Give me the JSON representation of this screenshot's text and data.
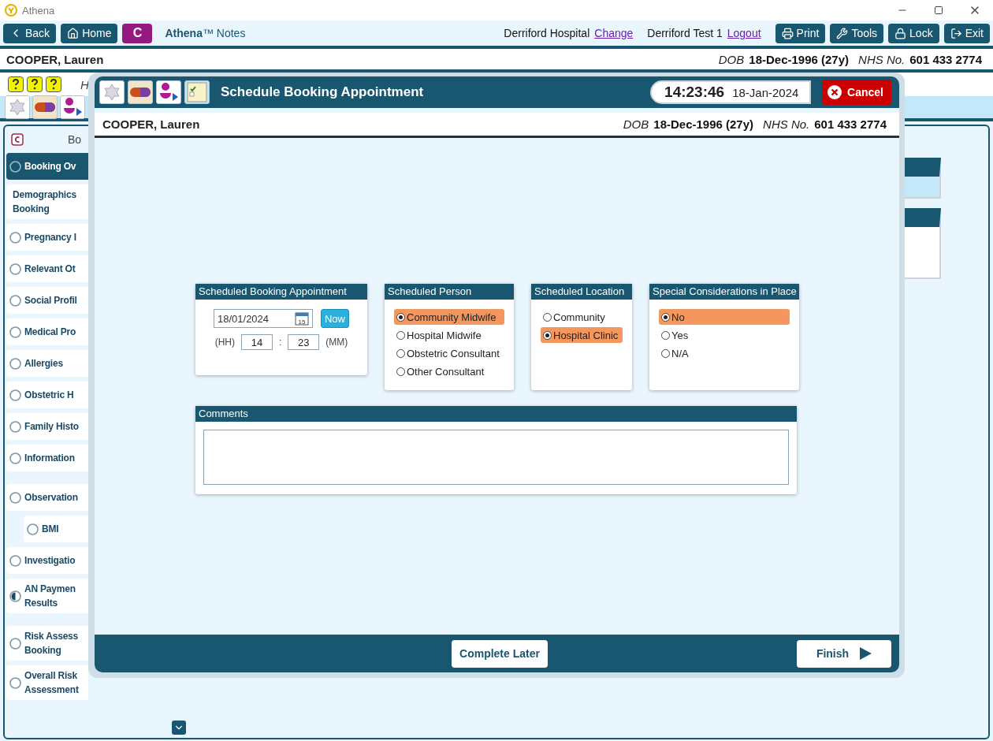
{
  "window": {
    "title": "Athena"
  },
  "toolbar": {
    "back": "Back",
    "home": "Home",
    "module": "C",
    "brand": "**Athena**™ Notes",
    "hospital": "Derriford Hospital",
    "change_link": "Change",
    "user": "Derriford Test 1",
    "logout_link": "Logout",
    "buttons": [
      {
        "kind": "print",
        "label": "Print"
      },
      {
        "kind": "tools",
        "label": "Tools"
      },
      {
        "kind": "lock",
        "label": "Lock"
      },
      {
        "kind": "exit",
        "label": "Exit"
      }
    ]
  },
  "patient": {
    "name": "COOPER, Lauren",
    "dob_label": "DOB",
    "dob": "18-Dec-1996 (27y)",
    "nhs_label": "NHS No.",
    "nhs": "601 433 2774"
  },
  "subheader": {
    "text": "H"
  },
  "sidebar": {
    "header": "Bo",
    "items": [
      {
        "label": "Booking Ov",
        "kind": "empty",
        "selected": true
      },
      {
        "label": "Demographics\nBooking",
        "kind": "plain",
        "selected": false
      },
      {
        "label": "Pregnancy I",
        "kind": "empty",
        "selected": false
      },
      {
        "label": "Relevant Ot",
        "kind": "empty",
        "selected": false
      },
      {
        "label": "Social Profil",
        "kind": "empty",
        "selected": false
      },
      {
        "label": "Medical Pro",
        "kind": "empty",
        "selected": false
      },
      {
        "label": "Allergies",
        "kind": "empty",
        "selected": false
      },
      {
        "label": "Obstetric H",
        "kind": "empty",
        "selected": false
      },
      {
        "label": "Family Histo",
        "kind": "empty",
        "selected": false
      },
      {
        "label": "Information",
        "kind": "empty",
        "selected": false
      },
      {
        "label": "Observation",
        "kind": "empty",
        "selected": false,
        "children": [
          {
            "label": "BMI",
            "kind": "empty",
            "selected": false
          }
        ]
      },
      {
        "label": "Investigatio",
        "kind": "empty",
        "selected": false
      },
      {
        "label": "AN Paymen\nResults",
        "kind": "partial",
        "selected": false
      },
      {
        "label": "Risk Assess\nBooking",
        "kind": "empty",
        "selected": false
      },
      {
        "label": "Overall Risk\nAssessment",
        "kind": "empty",
        "selected": false
      }
    ]
  },
  "dialog": {
    "title": "Schedule Booking Appointment",
    "time": "14:23:46",
    "date": "18-Jan-2024",
    "cancel": "Cancel",
    "patient": {
      "name": "COOPER, Lauren",
      "dob_label": "DOB",
      "dob": "18-Dec-1996 (27y)",
      "nhs_label": "NHS No.",
      "nhs": "601 433 2774"
    },
    "appointment": {
      "title": "Scheduled Booking Appointment",
      "date": "18/01/2024",
      "calendar_day": "15",
      "now": "Now",
      "hh_label": "(HH)",
      "hours": "14",
      "separator": ":",
      "minutes": "23",
      "mm_label": "(MM)"
    },
    "groups": [
      {
        "title": "Scheduled Person",
        "options": [
          {
            "label": "Community Midwife",
            "selected": true
          },
          {
            "label": "Hospital Midwife",
            "selected": false
          },
          {
            "label": "Obstetric Consultant",
            "selected": false
          },
          {
            "label": "Other Consultant",
            "selected": false
          }
        ]
      },
      {
        "title": "Scheduled Location",
        "options": [
          {
            "label": "Community",
            "selected": false
          },
          {
            "label": "Hospital Clinic",
            "selected": true
          }
        ]
      },
      {
        "title": "Special Considerations in Place",
        "options": [
          {
            "label": "No",
            "selected": true
          },
          {
            "label": "Yes",
            "selected": false
          },
          {
            "label": "N/A",
            "selected": false
          }
        ]
      }
    ],
    "comments": {
      "title": "Comments"
    },
    "complete_later": "Complete Later",
    "finish": "Finish"
  }
}
